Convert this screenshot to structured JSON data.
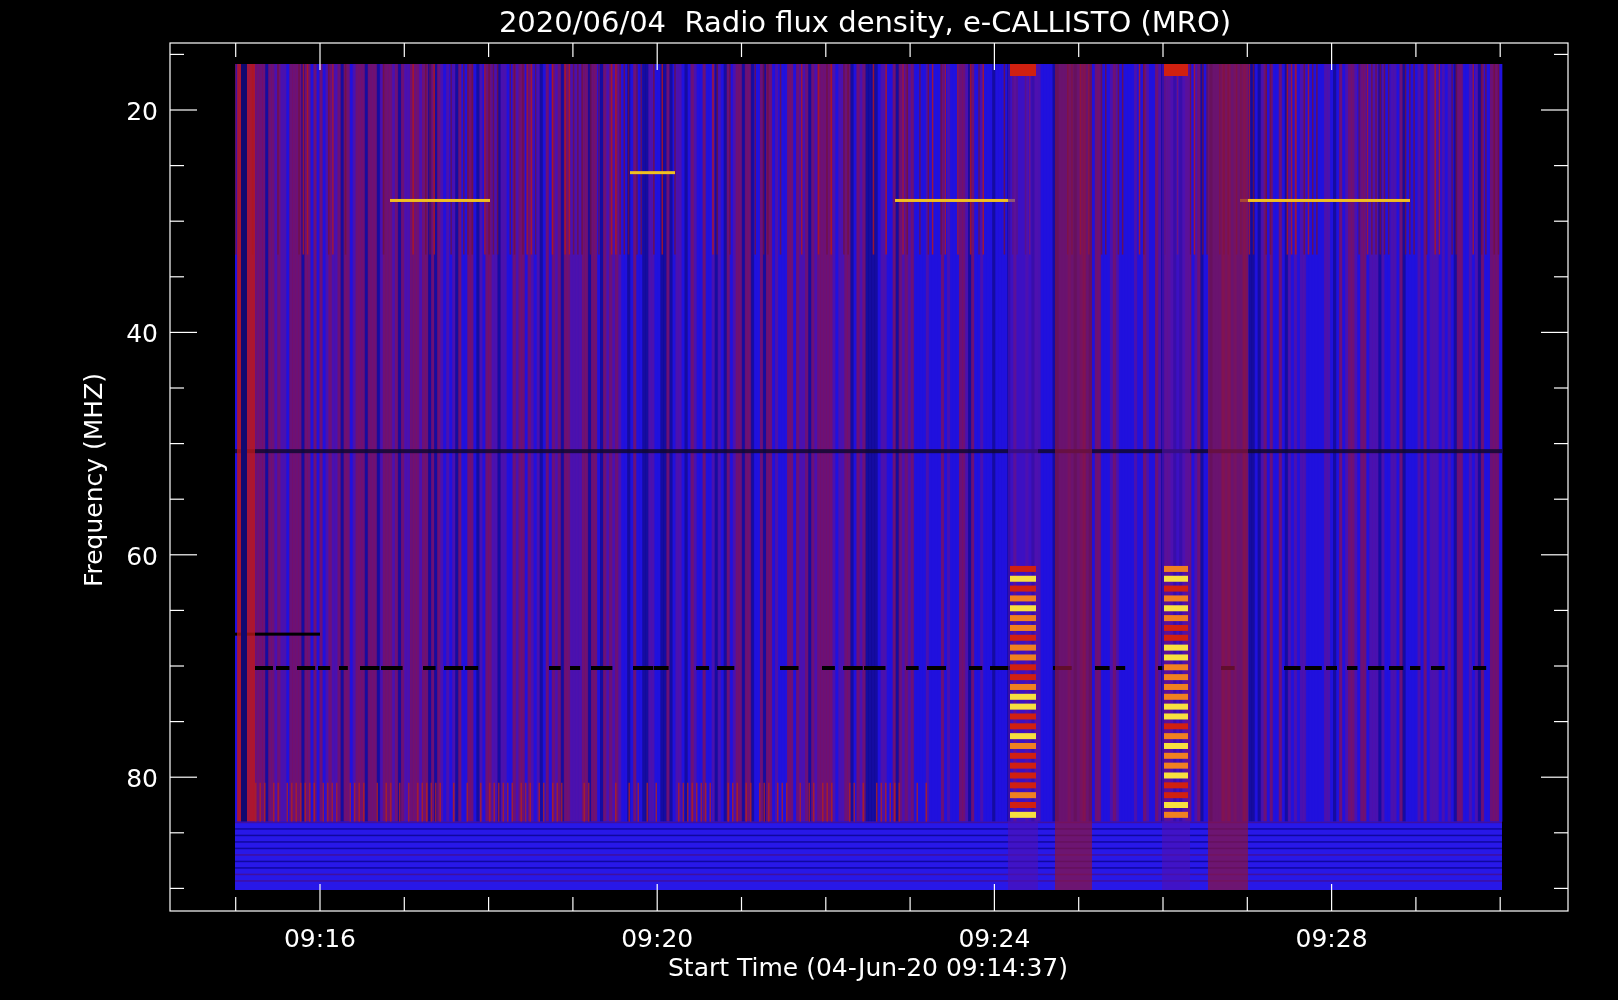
{
  "title": "2020/06/04  Radio flux density, e-CALLISTO (MRO)",
  "y_axis": {
    "label": "Frequency (MHZ)",
    "ticks": [
      "20",
      "40",
      "60",
      "80"
    ]
  },
  "x_axis": {
    "label": "Start Time (04-Jun-20 09:14:37)",
    "ticks": [
      "09:16",
      "09:20",
      "09:24",
      "09:28"
    ]
  }
}
